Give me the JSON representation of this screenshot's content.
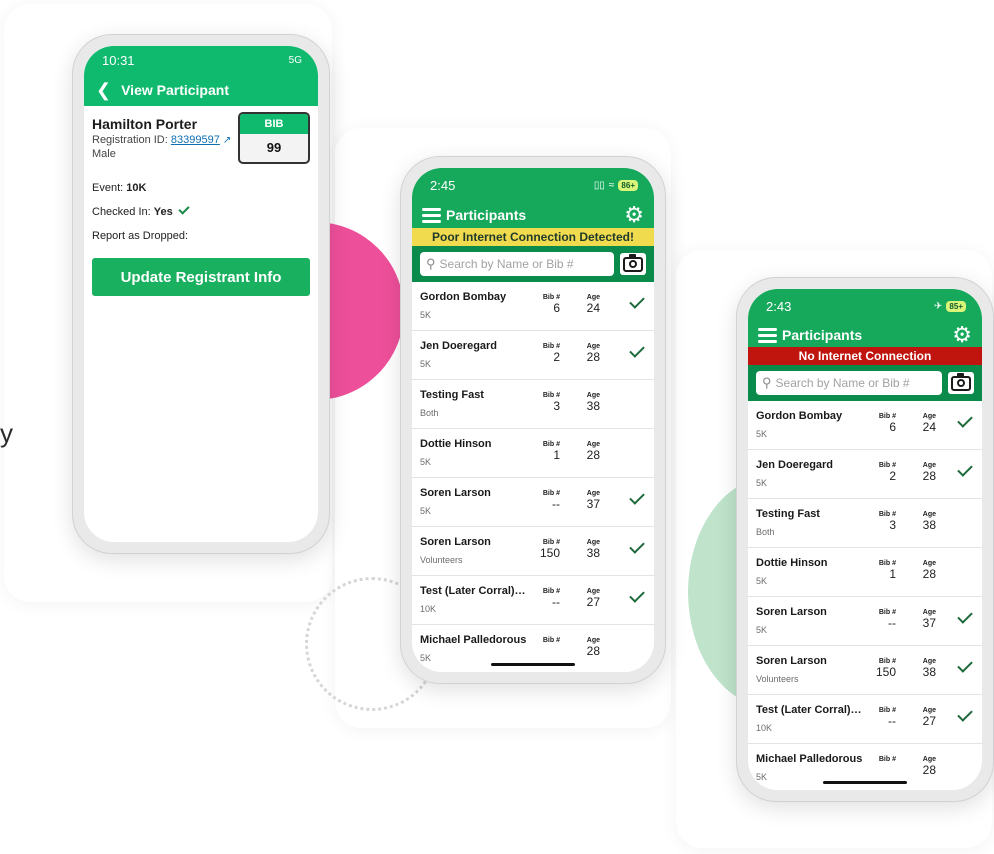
{
  "colors": {
    "brand_green": "#16a95c",
    "header_green": "#0a8a4b",
    "warn_yellow": "#f0db4f",
    "error_red": "#c0140e",
    "accent_pink": "#ee4f9a",
    "accent_mint": "#bfe3cb",
    "check_green": "#1d6a3a"
  },
  "decor": {
    "stray_text": "y"
  },
  "view_participant": {
    "status_time": "10:31",
    "status_right": "5G",
    "back_icon": "chevron-left-icon",
    "title": "View Participant",
    "name": "Hamilton Porter",
    "registration_label": "Registration ID:",
    "registration_id": "83399597",
    "gender": "Male",
    "bib_label": "BIB",
    "bib_number": "99",
    "event_label": "Event:",
    "event_value": "10K",
    "checked_in_label": "Checked In:",
    "checked_in_value": "Yes",
    "report_dropped_label": "Report as Dropped:",
    "update_button": "Update Registrant Info"
  },
  "phone_poor": {
    "status_time": "2:45",
    "battery": "86+",
    "title": "Participants",
    "banner": "Poor Internet Connection Detected!",
    "search_placeholder": "Search by Name or Bib #",
    "bib_label": "Bib #",
    "age_label": "Age",
    "participants": [
      {
        "name": "Gordon Bombay",
        "event": "5K",
        "bib": "6",
        "age": "24",
        "checked_in": true
      },
      {
        "name": "Jen Doeregard",
        "event": "5K",
        "bib": "2",
        "age": "28",
        "checked_in": true
      },
      {
        "name": "Testing Fast",
        "event": "Both",
        "bib": "3",
        "age": "38",
        "checked_in": false
      },
      {
        "name": "Dottie Hinson",
        "event": "5K",
        "bib": "1",
        "age": "28",
        "checked_in": false
      },
      {
        "name": "Soren Larson",
        "event": "5K",
        "bib": "--",
        "age": "37",
        "checked_in": true
      },
      {
        "name": "Soren Larson",
        "event": "Volunteers",
        "bib": "150",
        "age": "38",
        "checked_in": true
      },
      {
        "name": "Test (Later Corral) O...",
        "event": "10K",
        "bib": "--",
        "age": "27",
        "checked_in": true
      },
      {
        "name": "Michael Palledorous",
        "event": "5K",
        "bib": "",
        "age": "28",
        "checked_in": false
      }
    ]
  },
  "phone_offline": {
    "status_time": "2:43",
    "battery": "85+",
    "title": "Participants",
    "banner": "No Internet Connection",
    "search_placeholder": "Search by Name or Bib #",
    "bib_label": "Bib #",
    "age_label": "Age",
    "participants": [
      {
        "name": "Gordon Bombay",
        "event": "5K",
        "bib": "6",
        "age": "24",
        "checked_in": true
      },
      {
        "name": "Jen Doeregard",
        "event": "5K",
        "bib": "2",
        "age": "28",
        "checked_in": true
      },
      {
        "name": "Testing Fast",
        "event": "Both",
        "bib": "3",
        "age": "38",
        "checked_in": false
      },
      {
        "name": "Dottie Hinson",
        "event": "5K",
        "bib": "1",
        "age": "28",
        "checked_in": false
      },
      {
        "name": "Soren Larson",
        "event": "5K",
        "bib": "--",
        "age": "37",
        "checked_in": true
      },
      {
        "name": "Soren Larson",
        "event": "Volunteers",
        "bib": "150",
        "age": "38",
        "checked_in": true
      },
      {
        "name": "Test (Later Corral) O...",
        "event": "10K",
        "bib": "--",
        "age": "27",
        "checked_in": true
      },
      {
        "name": "Michael Palledorous",
        "event": "5K",
        "bib": "",
        "age": "28",
        "checked_in": false
      }
    ]
  }
}
